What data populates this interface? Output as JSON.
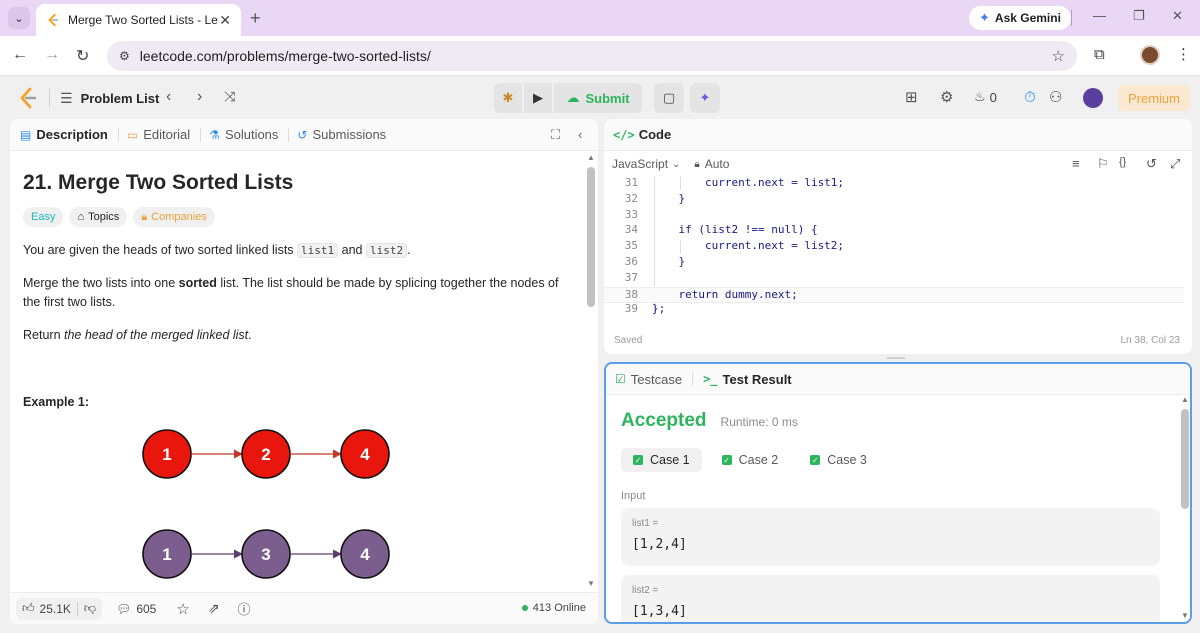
{
  "browser": {
    "tab_title": "Merge Two Sorted Lists - LeetC",
    "url": "leetcode.com/problems/merge-two-sorted-lists/",
    "ask_gemini": "Ask Gemini"
  },
  "header": {
    "problem_list": "Problem List",
    "submit": "Submit",
    "streak_count": "0",
    "premium": "Premium"
  },
  "left_tabs": {
    "description": "Description",
    "editorial": "Editorial",
    "solutions": "Solutions",
    "submissions": "Submissions"
  },
  "problem": {
    "title": "21. Merge Two Sorted Lists",
    "difficulty": "Easy",
    "topics": "Topics",
    "companies": "Companies",
    "p1_a": "You are given the heads of two sorted linked lists ",
    "p1_code1": "list1",
    "p1_b": " and ",
    "p1_code2": "list2",
    "p1_c": ".",
    "p2_a": "Merge the two lists into one ",
    "p2_bold": "sorted",
    "p2_b": " list. The list should be made by splicing together the nodes of the first two lists.",
    "p3_a": "Return ",
    "p3_italic": "the head of the merged linked list",
    "p3_b": ".",
    "example1": "Example 1:"
  },
  "diagram": {
    "list1": [
      "1",
      "2",
      "4"
    ],
    "list2": [
      "1",
      "3",
      "4"
    ],
    "list1_color": "#e8160c",
    "list2_color": "#7b5d8e"
  },
  "bottom_bar": {
    "likes": "25.1K",
    "comments": "605",
    "online": "413 Online"
  },
  "code_panel": {
    "title": "Code",
    "language": "JavaScript",
    "mode": "Auto",
    "lines": [
      {
        "n": "31",
        "text": "        current.next = list1;"
      },
      {
        "n": "32",
        "text": "    }"
      },
      {
        "n": "33",
        "text": ""
      },
      {
        "n": "34",
        "text": "    if (list2 !== null) {"
      },
      {
        "n": "35",
        "text": "        current.next = list2;"
      },
      {
        "n": "36",
        "text": "    }"
      },
      {
        "n": "37",
        "text": ""
      },
      {
        "n": "38",
        "text": "    return dummy.next;"
      },
      {
        "n": "39",
        "text": "};"
      }
    ],
    "saved": "Saved",
    "cursor": "Ln 38, Col 23"
  },
  "result_panel": {
    "testcase_tab": "Testcase",
    "result_tab": "Test Result",
    "status": "Accepted",
    "runtime": "Runtime: 0 ms",
    "cases": [
      "Case 1",
      "Case 2",
      "Case 3"
    ],
    "input_label": "Input",
    "inputs": [
      {
        "name": "list1 =",
        "value": "[1,2,4]"
      },
      {
        "name": "list2 =",
        "value": "[1,3,4]"
      }
    ]
  },
  "colors": {
    "accent_green": "#2db55d",
    "easy": "#1cb8b8",
    "premium": "#e8a23b",
    "result_border": "#5a9ee8"
  }
}
